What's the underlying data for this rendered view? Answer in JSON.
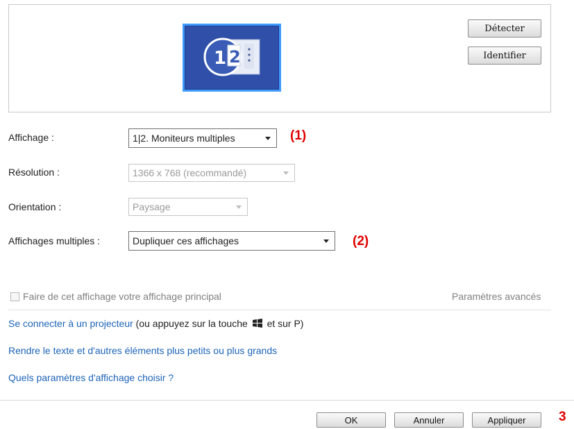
{
  "preview": {
    "detect_label": "Détecter",
    "identify_label": "Identifier",
    "monitor_numbers": "1 2"
  },
  "fields": {
    "display_label": "Affichage :",
    "display_value": "1|2. Moniteurs multiples",
    "resolution_label": "Résolution :",
    "resolution_value": "1366 x 768 (recommandé)",
    "orientation_label": "Orientation :",
    "orientation_value": "Paysage",
    "multiple_label": "Affichages multiples :",
    "multiple_value": "Dupliquer ces affichages"
  },
  "annotations": {
    "a1": "(1)",
    "a2": "(2)",
    "a3": "3"
  },
  "options": {
    "primary_checkbox_label": "Faire de cet affichage votre affichage principal",
    "primary_checked": false,
    "advanced_link": "Paramètres avancés"
  },
  "links": {
    "projector_link": "Se connecter à un projecteur",
    "projector_suffix_before": "(ou appuyez sur la touche",
    "projector_suffix_after": "et sur P)",
    "text_size_link": "Rendre le texte et d'autres éléments plus petits ou plus grands",
    "which_settings_link": "Quels paramètres d'affichage choisir ?"
  },
  "footer": {
    "ok_label": "OK",
    "cancel_label": "Annuler",
    "apply_label": "Appliquer"
  },
  "colors": {
    "link": "#1c63b7",
    "annotation": "#e00000",
    "monitor_fill": "#2f4fa8",
    "monitor_border": "#3f9bff"
  }
}
